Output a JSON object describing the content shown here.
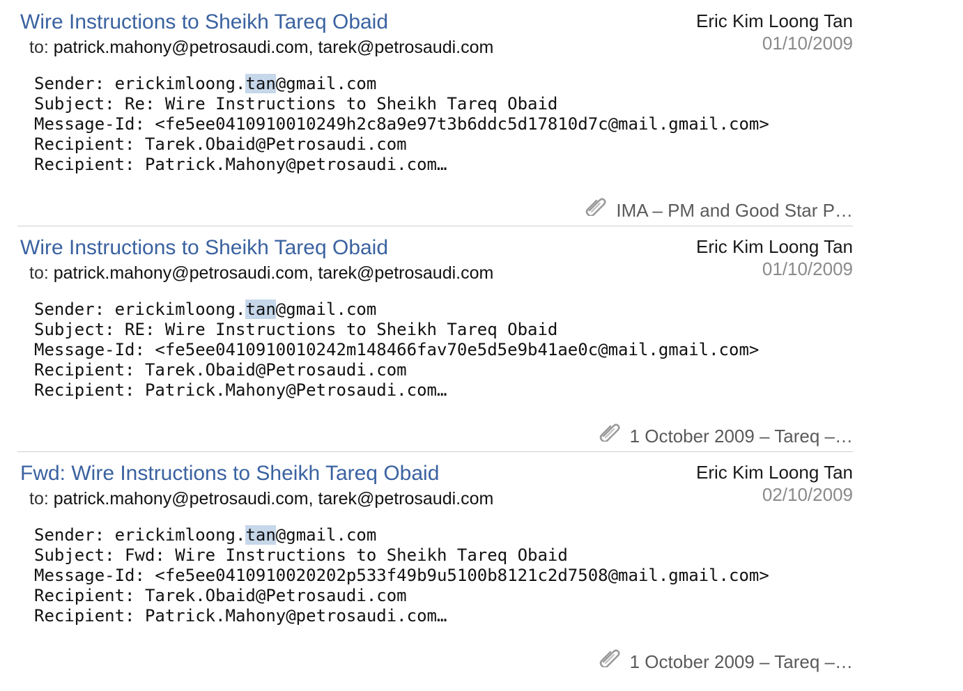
{
  "results": [
    {
      "subject": "Wire Instructions to Sheikh Tareq Obaid",
      "to_label": "to:",
      "to": "patrick.mahony@petrosaudi.com, tarek@petrosaudi.com",
      "from": "Eric Kim Loong Tan",
      "date": "01/10/2009",
      "sender_prefix": "Sender: erickimloong.",
      "sender_highlight": "tan",
      "sender_suffix": "@gmail.com",
      "subject_header": "Subject: Re: Wire Instructions to Sheikh Tareq Obaid",
      "message_id": "Message-Id: <fe5ee0410910010249h2c8a9e97t3b6ddc5d17810d7c@mail.gmail.com>",
      "recipient_1": "Recipient: Tarek.Obaid@Petrosaudi.com",
      "recipient_2": "Recipient: Patrick.Mahony@petrosaudi.com…",
      "attachment_icon": "paperclip-icon",
      "attachment": "IMA – PM and Good Star P…"
    },
    {
      "subject": "Wire Instructions to Sheikh Tareq Obaid",
      "to_label": "to:",
      "to": "patrick.mahony@petrosaudi.com, tarek@petrosaudi.com",
      "from": "Eric Kim Loong Tan",
      "date": "01/10/2009",
      "sender_prefix": "Sender: erickimloong.",
      "sender_highlight": "tan",
      "sender_suffix": "@gmail.com",
      "subject_header": "Subject: RE: Wire Instructions to Sheikh Tareq Obaid",
      "message_id": "Message-Id: <fe5ee0410910010242m148466fav70e5d5e9b41ae0c@mail.gmail.com>",
      "recipient_1": "Recipient: Tarek.Obaid@Petrosaudi.com",
      "recipient_2": "Recipient: Patrick.Mahony@Petrosaudi.com…",
      "attachment_icon": "paperclip-icon",
      "attachment": "1 October 2009 – Tareq –…"
    },
    {
      "subject": "Fwd: Wire Instructions to Sheikh Tareq Obaid",
      "to_label": "to:",
      "to": "patrick.mahony@petrosaudi.com, tarek@petrosaudi.com",
      "from": "Eric Kim Loong Tan",
      "date": "02/10/2009",
      "sender_prefix": "Sender: erickimloong.",
      "sender_highlight": "tan",
      "sender_suffix": "@gmail.com",
      "subject_header": "Subject: Fwd: Wire Instructions to Sheikh Tareq Obaid",
      "message_id": "Message-Id: <fe5ee0410910020202p533f49b9u5100b8121c2d7508@mail.gmail.com>",
      "recipient_1": "Recipient: Tarek.Obaid@Petrosaudi.com",
      "recipient_2": "Recipient: Patrick.Mahony@petrosaudi.com…",
      "attachment_icon": "paperclip-icon",
      "attachment": "1 October 2009 – Tareq –…"
    }
  ],
  "colors": {
    "subject_link": "#3a62a0",
    "date": "#8a8a8a",
    "highlight": "#c6d7ea",
    "divider": "#cfcfcf"
  }
}
